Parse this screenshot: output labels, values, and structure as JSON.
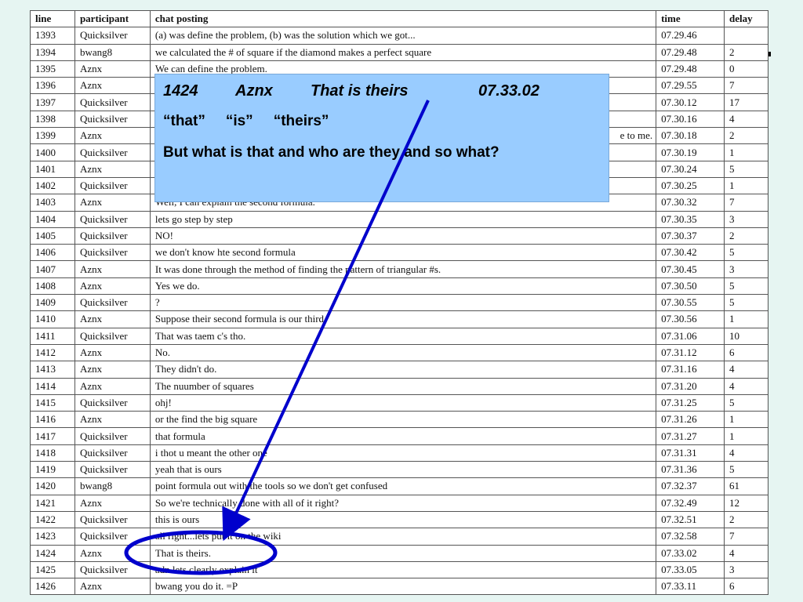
{
  "table": {
    "headers": [
      "line",
      "participant",
      "chat posting",
      "time",
      "delay"
    ],
    "rows": [
      [
        "1393",
        "Quicksilver",
        "(a) was define the problem, (b) was the solution which we got...",
        "07.29.46",
        ""
      ],
      [
        "1394",
        "bwang8",
        "we calculated the # of square if the diamond makes a perfect square",
        "07.29.48",
        "2"
      ],
      [
        "1395",
        "Aznx",
        "We can define the problem.",
        "07.29.48",
        "0"
      ],
      [
        "1396",
        "Aznx",
        "",
        "07.29.55",
        "7"
      ],
      [
        "1397",
        "Quicksilver",
        "",
        "07.30.12",
        "17"
      ],
      [
        "1398",
        "Quicksilver",
        "",
        "07.30.16",
        "4"
      ],
      [
        "1399",
        "Aznx",
        "e to me.",
        "07.30.18",
        "2"
      ],
      [
        "1400",
        "Quicksilver",
        "",
        "07.30.19",
        "1"
      ],
      [
        "1401",
        "Aznx",
        "",
        "07.30.24",
        "5"
      ],
      [
        "1402",
        "Quicksilver",
        "",
        "07.30.25",
        "1"
      ],
      [
        "1403",
        "Aznx",
        "Well, I can explain the second formula.",
        "07.30.32",
        "7"
      ],
      [
        "1404",
        "Quicksilver",
        "lets go step by step",
        "07.30.35",
        "3"
      ],
      [
        "1405",
        "Quicksilver",
        "NO!",
        "07.30.37",
        "2"
      ],
      [
        "1406",
        "Quicksilver",
        "we don't know hte second formula",
        "07.30.42",
        "5"
      ],
      [
        "1407",
        "Aznx",
        "It was done through the method of finding the pattern of triangular #s.",
        "07.30.45",
        "3"
      ],
      [
        "1408",
        "Aznx",
        "Yes we do.",
        "07.30.50",
        "5"
      ],
      [
        "1409",
        "Quicksilver",
        "?",
        "07.30.55",
        "5"
      ],
      [
        "1410",
        "Aznx",
        "Suppose their second formula is our third.",
        "07.30.56",
        "1"
      ],
      [
        "1411",
        "Quicksilver",
        "That was taem c's tho.",
        "07.31.06",
        "10"
      ],
      [
        "1412",
        "Aznx",
        "No.",
        "07.31.12",
        "6"
      ],
      [
        "1413",
        "Aznx",
        "They didn't do.",
        "07.31.16",
        "4"
      ],
      [
        "1414",
        "Aznx",
        "The nuumber of squares",
        "07.31.20",
        "4"
      ],
      [
        "1415",
        "Quicksilver",
        "ohj!",
        "07.31.25",
        "5"
      ],
      [
        "1416",
        "Aznx",
        "or the find the big square",
        "07.31.26",
        "1"
      ],
      [
        "1417",
        "Quicksilver",
        "that formula",
        "07.31.27",
        "1"
      ],
      [
        "1418",
        "Quicksilver",
        "i thot u meant the other one",
        "07.31.31",
        "4"
      ],
      [
        "1419",
        "Quicksilver",
        "yeah that is ours",
        "07.31.36",
        "5"
      ],
      [
        "1420",
        "bwang8",
        "point formula out with the tools so we don't get confused",
        "07.32.37",
        "61"
      ],
      [
        "1421",
        "Aznx",
        "So we're technically done with all of it right?",
        "07.32.49",
        "12"
      ],
      [
        "1422",
        "Quicksilver",
        "this is ours",
        "07.32.51",
        "2"
      ],
      [
        "1423",
        "Quicksilver",
        "all right...lets put it on the wiki",
        "07.32.58",
        "7"
      ],
      [
        "1424",
        "Aznx",
        "That is theirs.",
        "07.33.02",
        "4"
      ],
      [
        "1425",
        "Quicksilver",
        "adn lets clearly explain it",
        "07.33.05",
        "3"
      ],
      [
        "1426",
        "Aznx",
        "bwang you do it. =P",
        "07.33.11",
        "6"
      ]
    ]
  },
  "callout": {
    "line_num": "1424",
    "speaker": "Aznx",
    "quote": "That is theirs",
    "time": "07.33.02",
    "words": [
      "“that”",
      "“is”",
      "“theirs”"
    ],
    "question": "But what is that and who are they and so what?"
  },
  "colors": {
    "background": "#e6f5f2",
    "callout_fill": "#99ccff",
    "annotation_stroke": "#0000cc"
  }
}
